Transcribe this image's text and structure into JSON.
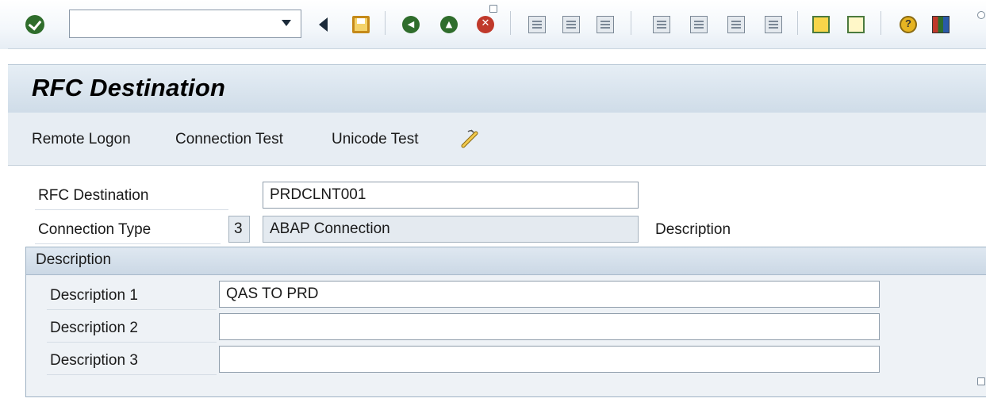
{
  "toolbar": {
    "command_field_value": "",
    "icons": [
      "enter-icon",
      "command-dropdown-icon",
      "back-triangle-icon",
      "save-icon",
      "back-icon",
      "exit-icon",
      "cancel-icon",
      "print-icon",
      "find-icon",
      "find-next-icon",
      "first-page-icon",
      "previous-page-icon",
      "next-page-icon",
      "last-page-icon",
      "create-session-icon",
      "shortcut-icon",
      "help-icon",
      "layout-icon"
    ]
  },
  "title": "RFC Destination",
  "app_toolbar": {
    "remote_logon": "Remote Logon",
    "connection_test": "Connection Test",
    "unicode_test": "Unicode Test"
  },
  "form": {
    "rfc_destination_label": "RFC Destination",
    "rfc_destination_value": "PRDCLNT001",
    "connection_type_label": "Connection Type",
    "connection_type_code": "3",
    "connection_type_text": "ABAP Connection",
    "description_label": "Description"
  },
  "description_group": {
    "title": "Description",
    "rows": [
      {
        "label": "Description 1",
        "value": "QAS TO PRD"
      },
      {
        "label": "Description 2",
        "value": ""
      },
      {
        "label": "Description 3",
        "value": ""
      }
    ]
  }
}
